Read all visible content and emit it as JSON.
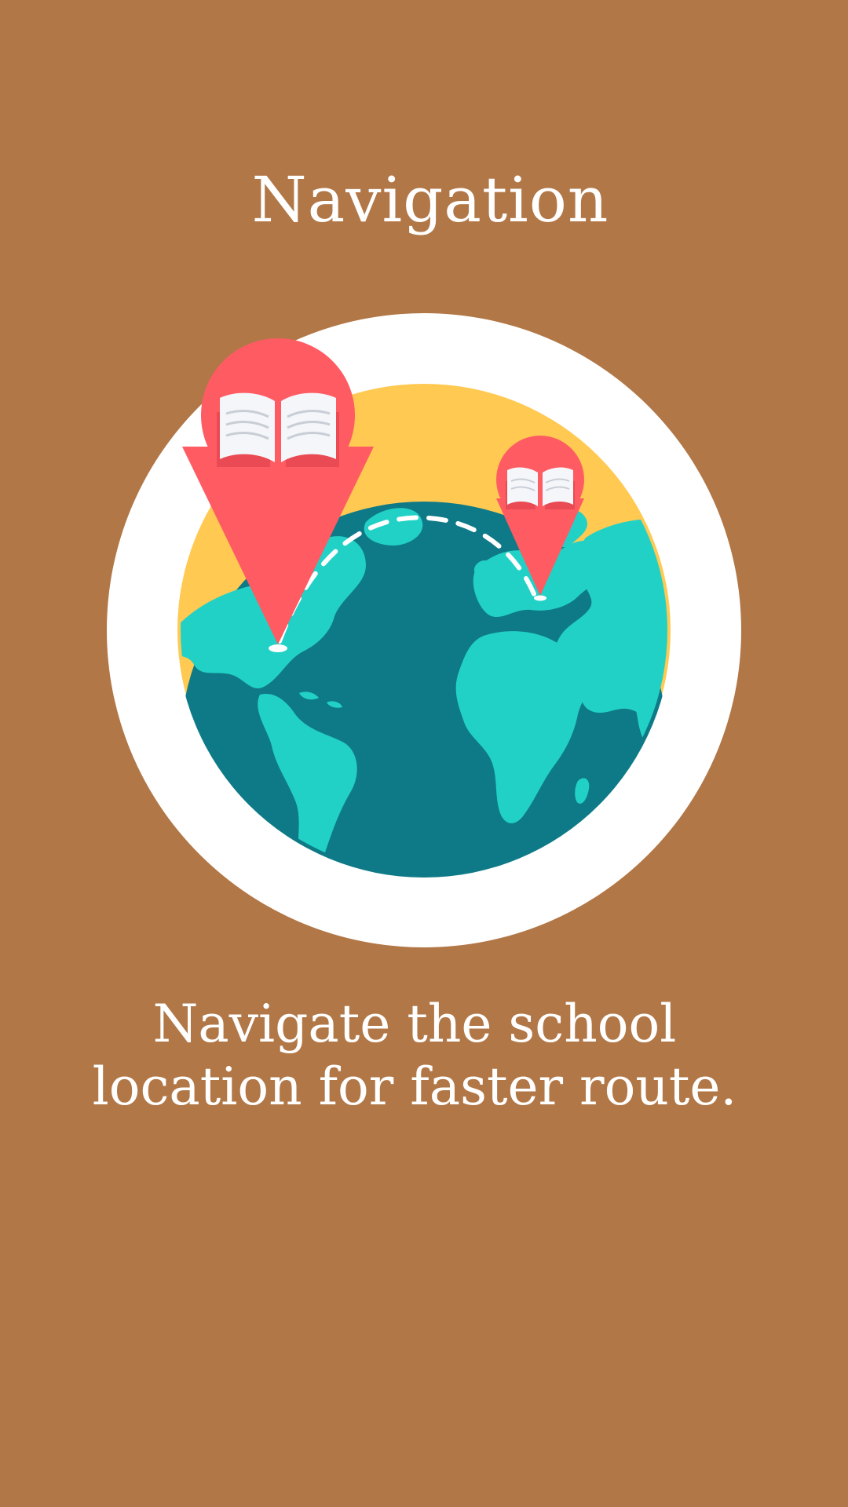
{
  "screen": {
    "title": "Navigation",
    "description": "Navigate the school location for faster route."
  },
  "colors": {
    "background": "#B27747",
    "text": "#FFFFFF",
    "outer_circle": "#FFFFFF",
    "sun": "#FFC952",
    "ocean": "#0E7A87",
    "land": "#22D1C5",
    "pin": "#FF5B63",
    "pin_dark": "#E94A53",
    "book_page": "#F4F6F9",
    "route": "#FFFFFF"
  },
  "illustration": {
    "icons": [
      "globe-icon",
      "map-pin-book-icon",
      "map-pin-book-icon",
      "route-path"
    ]
  }
}
